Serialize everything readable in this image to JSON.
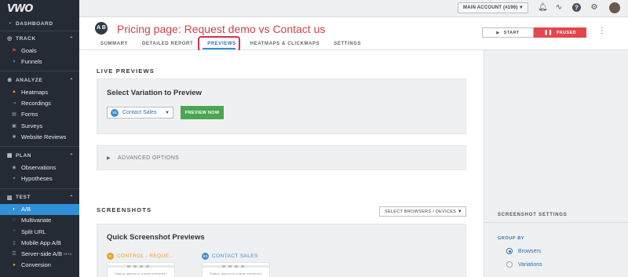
{
  "sidebar": {
    "logo": "VWO",
    "sections": [
      {
        "label": "DASHBOARD",
        "icon": "dashboard-icon"
      },
      {
        "label": "TRACK",
        "icon": "track-icon",
        "items": [
          "Goals",
          "Funnels"
        ]
      },
      {
        "label": "ANALYZE",
        "icon": "analyze-icon",
        "items": [
          "Heatmaps",
          "Recordings",
          "Forms",
          "Surveys",
          "Website Reviews"
        ]
      },
      {
        "label": "PLAN",
        "icon": "plan-icon",
        "items": [
          "Observations",
          "Hypotheses"
        ]
      },
      {
        "label": "TEST",
        "icon": "test-icon",
        "items": [
          "A/B",
          "Multivariate",
          "Split URL",
          "Mobile App A/B",
          "Server-side A/B",
          "Conversion"
        ]
      }
    ],
    "beta_label": "BETA",
    "active_item": "A/B"
  },
  "topbar": {
    "account_label": "MAIN ACCOUNT (#196)",
    "icons": [
      "bell-icon",
      "activity-icon",
      "help-icon",
      "settings-icon",
      "user-avatar"
    ]
  },
  "header": {
    "badge": "A B",
    "title": "Pricing page: Request demo vs Contact us",
    "tabs": [
      "SUMMARY",
      "DETAILED REPORT",
      "PREVIEWS",
      "HEATMAPS & CLICKMAPS",
      "SETTINGS"
    ],
    "active_tab": "PREVIEWS",
    "start_label": "START",
    "paused_label": "PAUSED"
  },
  "live_previews": {
    "section_title": "LIVE PREVIEWS",
    "card_title": "Select Variation to Preview",
    "variation_badge": "V1",
    "variation_value": "Contact Sales",
    "preview_button": "PREVIEW NOW",
    "advanced_options": "ADVANCED OPTIONS"
  },
  "screenshots": {
    "section_title": "SCREENSHOTS",
    "browser_select": "SELECT BROWSERS / DEVICES",
    "card_title": "Quick Screenshot Previews",
    "items": [
      {
        "badge": "C",
        "label": "CONTROL - REQUE...",
        "color": "#f0a020",
        "thumb_text": "Startup, agency or a large enterprise?"
      },
      {
        "badge": "V1",
        "label": "CONTACT SALES",
        "color": "#3a8dd8",
        "thumb_text": "Startup, agency or a large enterprise?"
      }
    ]
  },
  "screenshot_settings": {
    "title": "SCREENSHOT SETTINGS",
    "group_by": "GROUP BY",
    "options": [
      "Browsers",
      "Variations"
    ],
    "selected": "Browsers"
  }
}
